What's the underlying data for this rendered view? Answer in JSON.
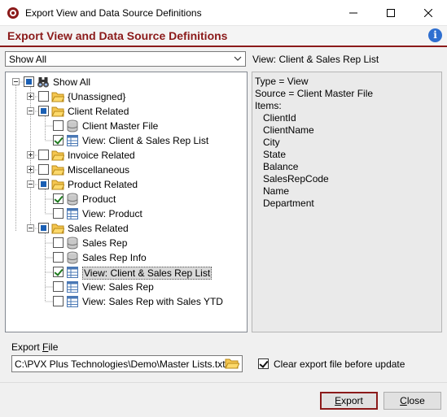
{
  "window": {
    "title": "Export View and Data Source Definitions"
  },
  "header": {
    "title": "Export View and Data Source Definitions"
  },
  "filter": {
    "selected": "Show All"
  },
  "view_label": "View: Client & Sales Rep List",
  "tree": [
    {
      "label": "Show All",
      "state": "partial",
      "icon": "binoculars-icon"
    },
    {
      "label": "{Unassigned}",
      "state": "unchecked",
      "icon": "folder-icon"
    },
    {
      "label": "Client Related",
      "state": "partial",
      "icon": "folder-icon"
    },
    {
      "label": "Client Master File",
      "state": "unchecked",
      "icon": "database-icon"
    },
    {
      "label": "View: Client & Sales Rep List",
      "state": "checked",
      "icon": "table-view-icon"
    },
    {
      "label": "Invoice Related",
      "state": "unchecked",
      "icon": "folder-icon"
    },
    {
      "label": "Miscellaneous",
      "state": "unchecked",
      "icon": "folder-icon"
    },
    {
      "label": "Product Related",
      "state": "partial",
      "icon": "folder-icon"
    },
    {
      "label": "Product",
      "state": "checked",
      "icon": "database-icon"
    },
    {
      "label": "View: Product",
      "state": "unchecked",
      "icon": "table-view-icon"
    },
    {
      "label": "Sales Related",
      "state": "partial",
      "icon": "folder-icon"
    },
    {
      "label": "Sales Rep",
      "state": "unchecked",
      "icon": "database-icon"
    },
    {
      "label": "Sales Rep Info",
      "state": "unchecked",
      "icon": "database-icon"
    },
    {
      "label": "View: Client & Sales Rep List",
      "state": "checked",
      "icon": "table-view-icon",
      "selected": true
    },
    {
      "label": "View: Sales Rep",
      "state": "unchecked",
      "icon": "table-view-icon"
    },
    {
      "label": "View: Sales Rep with Sales YTD",
      "state": "unchecked",
      "icon": "table-view-icon"
    }
  ],
  "details": {
    "type_line": "Type = View",
    "source_line": "Source = Client Master File",
    "items_heading": "Items:",
    "items": [
      "ClientId",
      "ClientName",
      "City",
      "State",
      "Balance",
      "SalesRepCode",
      "Name",
      "Department"
    ]
  },
  "export": {
    "label_pre": "Export ",
    "label_accel": "F",
    "label_post": "ile",
    "path": "C:\\PVX Plus Technologies\\Demo\\Master Lists.txt",
    "clear_label": "Clear export file before update",
    "clear_checked": true
  },
  "buttons": {
    "export_accel": "E",
    "export_rest": "xport",
    "close_accel": "C",
    "close_rest": "lose"
  },
  "colors": {
    "accent": "#8b1a1a",
    "check": "#1e7a1e",
    "partial": "#1a5fb4"
  }
}
